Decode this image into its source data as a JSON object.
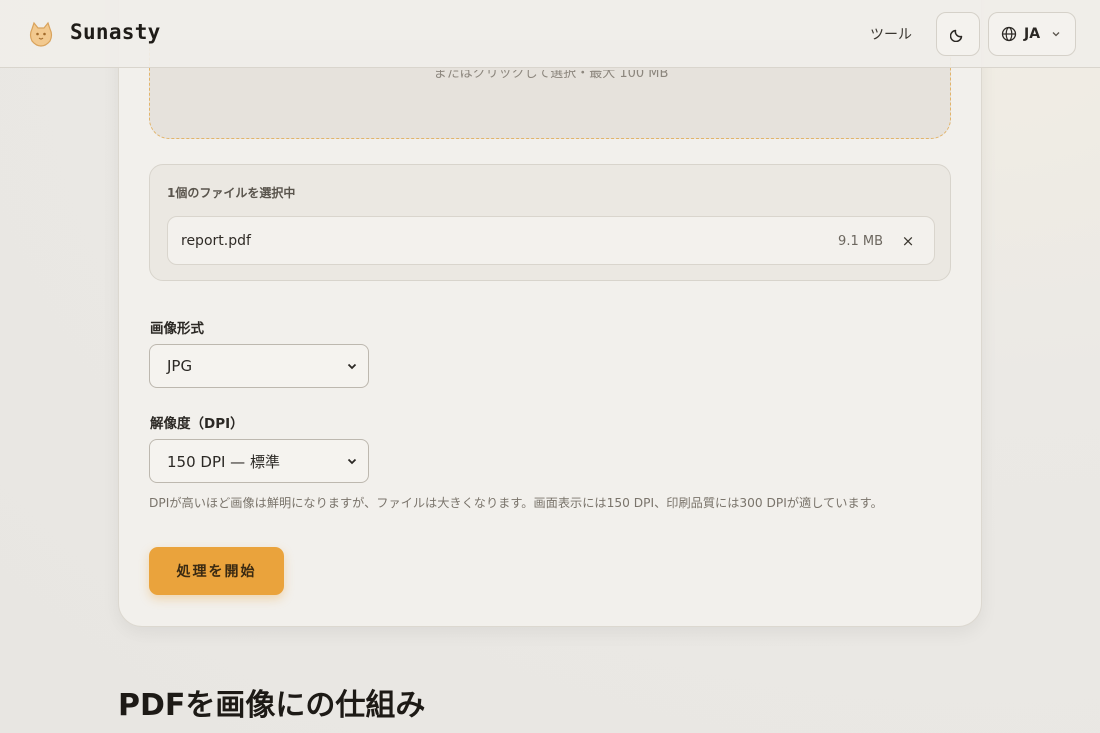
{
  "header": {
    "brand": "Sunasty",
    "nav_tools": "ツール",
    "language": "JA"
  },
  "dropzone": {
    "hint": "またはクリックして選択・最大 100 MB"
  },
  "files": {
    "count_label": "1個のファイルを選択中",
    "items": [
      {
        "name": "report.pdf",
        "size": "9.1 MB",
        "remove": "×"
      }
    ]
  },
  "format": {
    "label": "画像形式",
    "value": "JPG"
  },
  "resolution": {
    "label": "解像度（DPI）",
    "value": "150 DPI — 標準",
    "help": "DPIが高いほど画像は鮮明になりますが、ファイルは大きくなります。画面表示には150 DPI、印刷品質には300 DPIが適しています。"
  },
  "actions": {
    "start": "処理を開始"
  },
  "section": {
    "title": "PDFを画像にの仕組み"
  },
  "colors": {
    "accent": "#eaa33c",
    "dashed_border": "#e2b46b"
  }
}
